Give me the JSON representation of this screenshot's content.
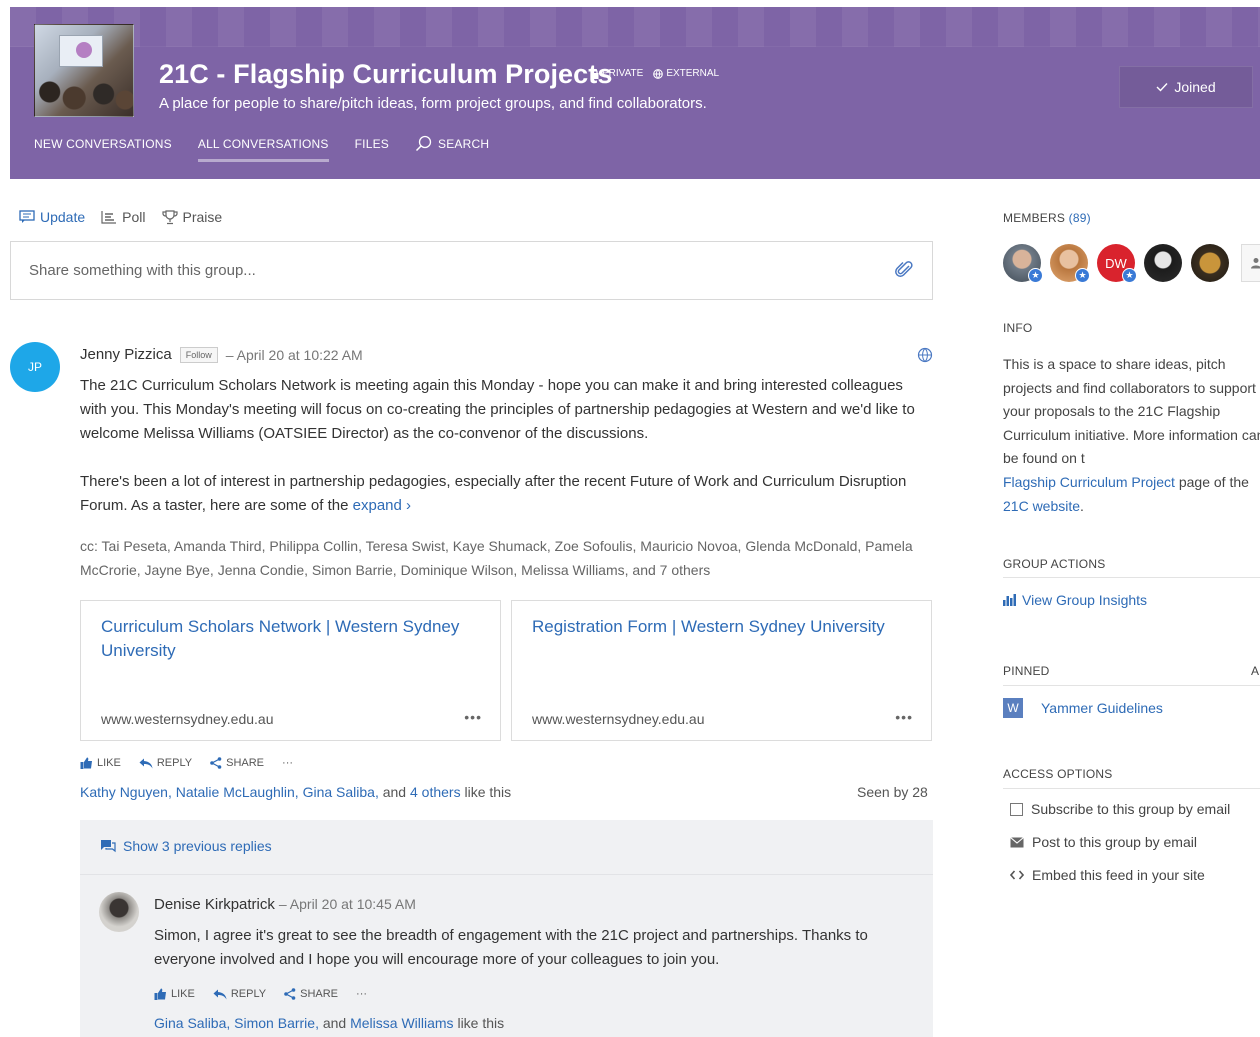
{
  "group": {
    "title": "21C - Flagship Curriculum Projects",
    "private_label": "PRIVATE",
    "external_label": "EXTERNAL",
    "description": "A place for people to share/pitch ideas, form project groups, and find collaborators.",
    "joined_label": "Joined"
  },
  "nav": {
    "items": [
      "NEW CONVERSATIONS",
      "ALL CONVERSATIONS",
      "FILES",
      "SEARCH"
    ],
    "active": "ALL CONVERSATIONS"
  },
  "publisher": {
    "tabs": [
      "Update",
      "Poll",
      "Praise"
    ],
    "placeholder": "Share something with this group..."
  },
  "thread": {
    "avatar_initials": "JP",
    "author": "Jenny Pizzica",
    "follow_label": "Follow",
    "meta": "– April 20 at 10:22 AM",
    "body_p1": "The 21C Curriculum Scholars Network is meeting again this Monday - hope you can make it and bring interested colleagues with you. This Monday's meeting will focus on co-creating the principles of partnership pedagogies at Western and we'd like to welcome Melissa Williams (OATSIEE Director) as the co-convenor of the discussions.",
    "body_p2_text": "There's been a lot of interest in partnership pedagogies, especially after the recent Future of Work and Curriculum Disruption Forum. As a taster, here are some of the ",
    "expand_label": "expand ›",
    "cc": "cc: Tai Peseta, Amanda Third, Philippa Collin, Teresa Swist, Kaye Shumack, Zoe Sofoulis, Mauricio Novoa, Glenda McDonald, Pamela McCrorie, Jayne Bye, Jenna Condie, Simon Barrie, Dominique Wilson, Melissa Williams, and 7 others",
    "cards": [
      {
        "title": "Curriculum Scholars Network | Western Sydney University",
        "url": "www.westernsydney.edu.au",
        "more": "•••"
      },
      {
        "title": "Registration Form | Western Sydney University",
        "url": "www.westernsydney.edu.au",
        "more": "•••"
      }
    ],
    "actions": {
      "like": "LIKE",
      "reply": "REPLY",
      "share": "SHARE",
      "more": "···"
    },
    "likes": {
      "names": "Kathy Nguyen, Natalie McLaughlin, Gina Saliba,",
      "and": " and ",
      "others": "4 others",
      "suffix": " like this"
    },
    "seen": "Seen by 28",
    "show_previous": "Show 3 previous replies",
    "reply": {
      "author": "Denise Kirkpatrick",
      "meta": "– April 20 at 10:45 AM",
      "body": "Simon, I agree it's great to see the breadth of engagement with the 21C project and partnerships. Thanks to everyone involved and I hope you will encourage more of your colleagues to join you.",
      "likes_names": "Gina Saliba, Simon Barrie,",
      "likes_and": " and ",
      "likes_last": "Melissa Williams",
      "likes_suffix": " like this"
    }
  },
  "rail": {
    "members_label": "MEMBERS",
    "members_count": "(89)",
    "member_initials_dw": "DW",
    "info_label": "INFO",
    "info_text_1": "This is a space to share ideas, pitch projects and find collaborators to support your proposals to the 21C Flagship Curriculum initiative. More information can be found on t",
    "info_link_1": "Flagship Curriculum Project",
    "info_text_2": " page of the ",
    "info_link_2": "21C website",
    "info_text_3": ".",
    "group_actions_label": "GROUP ACTIONS",
    "insights_label": "View Group Insights",
    "pinned_label": "PINNED",
    "pinned_add": "A",
    "pinned_item": "Yammer Guidelines",
    "pinned_icon_letter": "W",
    "access_label": "ACCESS OPTIONS",
    "access_items": [
      "Subscribe to this group by email",
      "Post to this group by email",
      "Embed this feed in your site"
    ]
  },
  "colors": {
    "header_purple": "#7e64a6",
    "link_blue": "#2e6bb6",
    "avatar_blue": "#1ea7e8",
    "dw_red": "#d9232d"
  }
}
